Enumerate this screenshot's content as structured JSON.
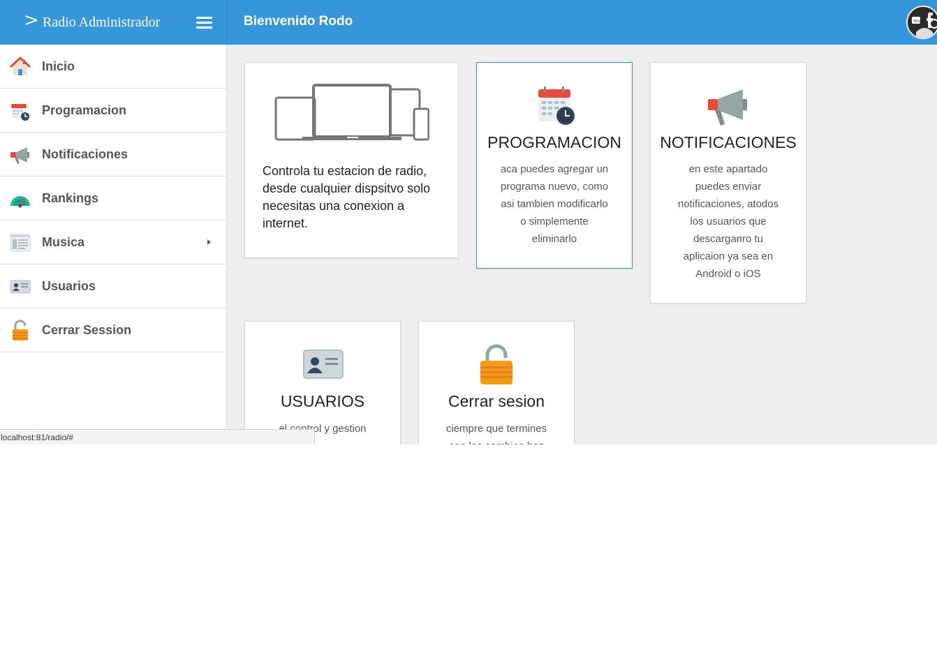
{
  "header": {
    "brand_chevron": ">",
    "brand_title": "Radio Administrador",
    "welcome": "Bienvenido Rodo",
    "menu_icon": "hamburger-icon",
    "avatar_icon": "user-avatar"
  },
  "sidebar": {
    "items": [
      {
        "label": "Inicio",
        "icon": "home-icon"
      },
      {
        "label": "Programacion",
        "icon": "calendar-icon"
      },
      {
        "label": "Notificaciones",
        "icon": "megaphone-icon"
      },
      {
        "label": "Rankings",
        "icon": "gauge-icon"
      },
      {
        "label": "Musica",
        "icon": "list-window-icon",
        "has_submenu": true
      },
      {
        "label": "Usuarios",
        "icon": "id-card-icon"
      },
      {
        "label": "Cerrar Session",
        "icon": "padlock-icon"
      }
    ]
  },
  "cards": {
    "intro": {
      "icon": "devices-icon",
      "text": "Controla tu estacion de radio, desde cualquier dispsitvo solo necesitas una conexion a internet."
    },
    "programacion": {
      "icon": "calendar-icon",
      "title": "PROGRAMACION",
      "lines": [
        "aca puedes agregar un",
        "programa nuevo, como",
        "asi tambien modificarlo",
        "o simplemente",
        "eliminarlo"
      ]
    },
    "notificaciones": {
      "icon": "megaphone-icon",
      "title": "NOTIFICACIONES",
      "lines": [
        "en este apartado",
        "puedes enviar",
        "notificaciones, atodos",
        "los usuarios que",
        "descarganro tu",
        "aplicaion ya sea en",
        "Android o iOS"
      ]
    },
    "usuarios": {
      "icon": "id-card-icon",
      "title": "USUARIOS",
      "lines": [
        "el control y gestion"
      ]
    },
    "cerrar": {
      "icon": "padlock-icon",
      "title": "Cerrar sesion",
      "lines": [
        "ciempre que termines",
        "con los cambios haz"
      ]
    }
  },
  "status_bar": {
    "url": "localhost:81/radio/#"
  },
  "colors": {
    "header_blue": "#3596d9",
    "content_bg": "#eeeeee",
    "active_border": "#3a87c8"
  }
}
